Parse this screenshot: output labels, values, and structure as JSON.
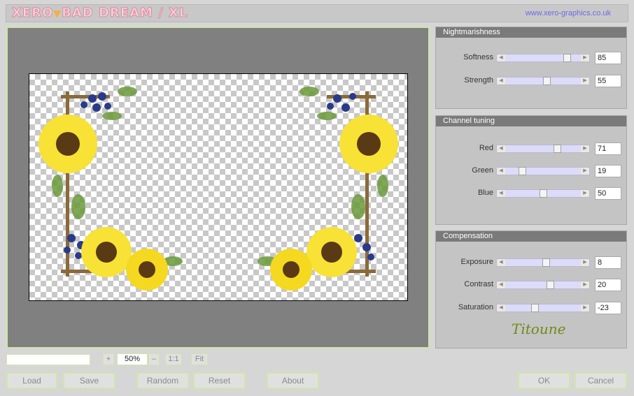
{
  "title": {
    "logo_part1": "XERO",
    "logo_part2": "BAD DREAM / XL",
    "url": "www.xero-graphics.co.uk"
  },
  "panels": {
    "nightmarishness": {
      "title": "Nightmarishness",
      "sliders": [
        {
          "label": "Softness",
          "value": "85",
          "level": 0.85
        },
        {
          "label": "Strength",
          "value": "55",
          "level": 0.55
        }
      ]
    },
    "channel": {
      "title": "Channel tuning",
      "sliders": [
        {
          "label": "Red",
          "value": "71",
          "level": 0.71
        },
        {
          "label": "Green",
          "value": "19",
          "level": 0.19
        },
        {
          "label": "Blue",
          "value": "50",
          "level": 0.5
        }
      ]
    },
    "compensation": {
      "title": "Compensation",
      "sliders": [
        {
          "label": "Exposure",
          "value": "8",
          "level": 0.54
        },
        {
          "label": "Contrast",
          "value": "20",
          "level": 0.6
        },
        {
          "label": "Saturation",
          "value": "-23",
          "level": 0.38
        }
      ]
    },
    "signature": "Titoune"
  },
  "zoom": {
    "plus": "+",
    "value": "50%",
    "minus": "–",
    "one_to_one": "1:1",
    "fit": "Fit"
  },
  "buttons": {
    "load": "Load",
    "save": "Save",
    "random": "Random",
    "reset": "Reset",
    "about": "About",
    "ok": "OK",
    "cancel": "Cancel"
  },
  "colors": {
    "accent_border": "#cfe6a8",
    "panel_header": "#7a7a7a",
    "slider_track": "#dcdcf8"
  }
}
